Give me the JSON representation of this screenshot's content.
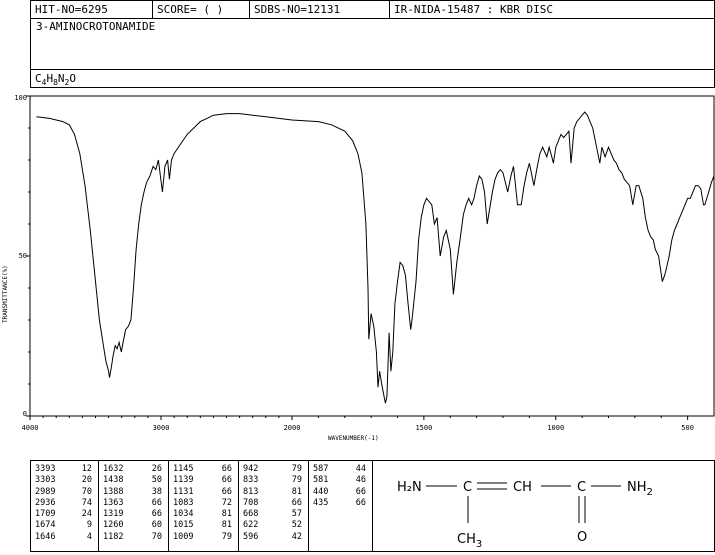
{
  "header": {
    "hit_no": "HIT-NO=6295",
    "score": "SCORE=  (  )",
    "sdbs_no": "SDBS-NO=12131",
    "ir_nida": "IR-NIDA-15487 : KBR DISC"
  },
  "compound": {
    "name": "3-AMINOCROTONAMIDE",
    "formula": {
      "c": "C",
      "c_n": "4",
      "h": "H",
      "h_n": "8",
      "n": "N",
      "n_n": "2",
      "o": "O"
    }
  },
  "chart_data": {
    "type": "line",
    "xlabel": "WAVENUMBER(-1)",
    "ylabel": "TRANSMITTANCE(%)",
    "xlim": [
      4000,
      400
    ],
    "ylim": [
      0,
      100
    ],
    "x_ticks": [
      "4000",
      "3000",
      "2000",
      "1500",
      "1000",
      "500"
    ],
    "y_ticks": [
      "100",
      "50",
      "0"
    ],
    "series": [
      {
        "points": [
          [
            3950,
            93.5
          ],
          [
            3850,
            93
          ],
          [
            3750,
            92
          ],
          [
            3700,
            91
          ],
          [
            3660,
            88
          ],
          [
            3620,
            82
          ],
          [
            3580,
            72
          ],
          [
            3540,
            58
          ],
          [
            3500,
            42
          ],
          [
            3470,
            30
          ],
          [
            3440,
            22
          ],
          [
            3420,
            17
          ],
          [
            3400,
            14
          ],
          [
            3393,
            12
          ],
          [
            3380,
            15
          ],
          [
            3365,
            19
          ],
          [
            3350,
            22
          ],
          [
            3335,
            21
          ],
          [
            3320,
            23
          ],
          [
            3303,
            20
          ],
          [
            3285,
            24
          ],
          [
            3270,
            27
          ],
          [
            3250,
            28
          ],
          [
            3230,
            30
          ],
          [
            3210,
            40
          ],
          [
            3190,
            52
          ],
          [
            3170,
            60
          ],
          [
            3150,
            66
          ],
          [
            3130,
            70
          ],
          [
            3110,
            73
          ],
          [
            3085,
            75
          ],
          [
            3060,
            78
          ],
          [
            3040,
            77
          ],
          [
            3020,
            80
          ],
          [
            2989,
            70
          ],
          [
            2970,
            78
          ],
          [
            2950,
            80
          ],
          [
            2936,
            74
          ],
          [
            2920,
            80
          ],
          [
            2900,
            82
          ],
          [
            2850,
            85
          ],
          [
            2800,
            88
          ],
          [
            2750,
            90
          ],
          [
            2700,
            92
          ],
          [
            2650,
            93
          ],
          [
            2600,
            94
          ],
          [
            2500,
            94.5
          ],
          [
            2400,
            94.5
          ],
          [
            2300,
            94
          ],
          [
            2200,
            93.5
          ],
          [
            2100,
            93
          ],
          [
            2000,
            92.5
          ],
          [
            1900,
            92
          ],
          [
            1850,
            91
          ],
          [
            1800,
            89
          ],
          [
            1770,
            86
          ],
          [
            1750,
            82
          ],
          [
            1735,
            76
          ],
          [
            1720,
            60
          ],
          [
            1712,
            40
          ],
          [
            1709,
            24
          ],
          [
            1700,
            32
          ],
          [
            1690,
            28
          ],
          [
            1680,
            20
          ],
          [
            1674,
            9
          ],
          [
            1668,
            14
          ],
          [
            1660,
            10
          ],
          [
            1653,
            7
          ],
          [
            1646,
            4
          ],
          [
            1640,
            6
          ],
          [
            1632,
            26
          ],
          [
            1625,
            14
          ],
          [
            1618,
            20
          ],
          [
            1610,
            35
          ],
          [
            1600,
            42
          ],
          [
            1590,
            48
          ],
          [
            1580,
            47
          ],
          [
            1570,
            44
          ],
          [
            1560,
            35
          ],
          [
            1550,
            27
          ],
          [
            1545,
            30
          ],
          [
            1530,
            42
          ],
          [
            1520,
            55
          ],
          [
            1510,
            62
          ],
          [
            1500,
            66
          ],
          [
            1490,
            68
          ],
          [
            1480,
            67
          ],
          [
            1470,
            66
          ],
          [
            1460,
            60
          ],
          [
            1450,
            62
          ],
          [
            1438,
            50
          ],
          [
            1425,
            56
          ],
          [
            1415,
            58
          ],
          [
            1400,
            52
          ],
          [
            1388,
            38
          ],
          [
            1375,
            48
          ],
          [
            1363,
            55
          ],
          [
            1350,
            63
          ],
          [
            1340,
            66
          ],
          [
            1330,
            68
          ],
          [
            1319,
            66
          ],
          [
            1310,
            68
          ],
          [
            1300,
            72
          ],
          [
            1290,
            75
          ],
          [
            1280,
            74
          ],
          [
            1270,
            70
          ],
          [
            1260,
            60
          ],
          [
            1250,
            65
          ],
          [
            1240,
            70
          ],
          [
            1230,
            74
          ],
          [
            1220,
            76
          ],
          [
            1210,
            77
          ],
          [
            1200,
            76
          ],
          [
            1182,
            70
          ],
          [
            1170,
            75
          ],
          [
            1160,
            78
          ],
          [
            1145,
            66
          ],
          [
            1139,
            66
          ],
          [
            1131,
            66
          ],
          [
            1120,
            72
          ],
          [
            1110,
            76
          ],
          [
            1100,
            79
          ],
          [
            1083,
            72
          ],
          [
            1070,
            78
          ],
          [
            1060,
            82
          ],
          [
            1050,
            84
          ],
          [
            1034,
            81
          ],
          [
            1025,
            84
          ],
          [
            1015,
            81
          ],
          [
            1009,
            79
          ],
          [
            1000,
            84
          ],
          [
            990,
            86
          ],
          [
            980,
            88
          ],
          [
            970,
            87
          ],
          [
            960,
            88
          ],
          [
            950,
            89
          ],
          [
            942,
            79
          ],
          [
            930,
            90
          ],
          [
            920,
            92
          ],
          [
            910,
            93
          ],
          [
            900,
            94
          ],
          [
            890,
            95
          ],
          [
            880,
            94
          ],
          [
            870,
            92
          ],
          [
            860,
            90
          ],
          [
            850,
            86
          ],
          [
            833,
            79
          ],
          [
            825,
            84
          ],
          [
            813,
            81
          ],
          [
            800,
            84
          ],
          [
            790,
            82
          ],
          [
            780,
            80
          ],
          [
            770,
            79
          ],
          [
            760,
            77
          ],
          [
            750,
            76
          ],
          [
            740,
            74
          ],
          [
            730,
            73
          ],
          [
            720,
            72
          ],
          [
            708,
            66
          ],
          [
            695,
            72
          ],
          [
            685,
            72
          ],
          [
            670,
            68
          ],
          [
            660,
            62
          ],
          [
            650,
            58
          ],
          [
            640,
            56
          ],
          [
            630,
            55
          ],
          [
            622,
            52
          ],
          [
            610,
            50
          ],
          [
            596,
            42
          ],
          [
            587,
            44
          ],
          [
            581,
            46
          ],
          [
            570,
            50
          ],
          [
            560,
            55
          ],
          [
            550,
            58
          ],
          [
            540,
            60
          ],
          [
            530,
            62
          ],
          [
            520,
            64
          ],
          [
            510,
            66
          ],
          [
            500,
            68
          ],
          [
            490,
            68
          ],
          [
            480,
            70
          ],
          [
            470,
            72
          ],
          [
            460,
            72
          ],
          [
            450,
            71
          ],
          [
            440,
            66
          ],
          [
            435,
            66
          ],
          [
            420,
            70
          ],
          [
            410,
            73
          ],
          [
            400,
            75
          ]
        ]
      }
    ],
    "grid": false
  },
  "peaks": {
    "columns": [
      [
        [
          "3393",
          "12"
        ],
        [
          "3303",
          "20"
        ],
        [
          "2989",
          "70"
        ],
        [
          "2936",
          "74"
        ],
        [
          "1709",
          "24"
        ],
        [
          "1674",
          "9"
        ],
        [
          "1646",
          "4"
        ]
      ],
      [
        [
          "1632",
          "26"
        ],
        [
          "1438",
          "50"
        ],
        [
          "1388",
          "38"
        ],
        [
          "1363",
          "66"
        ],
        [
          "1319",
          "66"
        ],
        [
          "1260",
          "60"
        ],
        [
          "1182",
          "70"
        ]
      ],
      [
        [
          "1145",
          "66"
        ],
        [
          "1139",
          "66"
        ],
        [
          "1131",
          "66"
        ],
        [
          "1083",
          "72"
        ],
        [
          "1034",
          "81"
        ],
        [
          "1015",
          "81"
        ],
        [
          "1009",
          "79"
        ]
      ],
      [
        [
          "942",
          "79"
        ],
        [
          "833",
          "79"
        ],
        [
          "813",
          "81"
        ],
        [
          "708",
          "66"
        ],
        [
          "668",
          "57"
        ],
        [
          "622",
          "52"
        ],
        [
          "596",
          "42"
        ]
      ],
      [
        [
          "587",
          "44"
        ],
        [
          "581",
          "46"
        ],
        [
          "440",
          "66"
        ],
        [
          "435",
          "66"
        ]
      ]
    ]
  },
  "structure": {
    "h2n": "H2N",
    "c1": "C",
    "ch": "CH",
    "c2": "C",
    "nh2": "NH2",
    "ch3": "CH3",
    "o": "O"
  }
}
